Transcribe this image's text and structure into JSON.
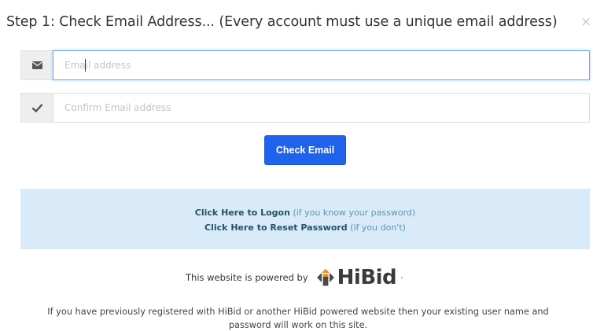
{
  "header": {
    "title": "Step 1: Check Email Address... (Every account must use a unique email address)",
    "close_label": "×"
  },
  "form": {
    "email_placeholder": "Email address",
    "confirm_placeholder": "Confirm Email address",
    "submit_label": "Check Email",
    "email_icon": "envelope-icon",
    "confirm_icon": "checkmark-icon"
  },
  "info": {
    "logon_link": "Click Here to Logon",
    "logon_note": "(if you know your password)",
    "reset_link": "Click Here to Reset Password",
    "reset_note": "(if you don't)"
  },
  "powered": {
    "text": "This website is powered by",
    "brand": "HiBid",
    "suffix": "·"
  },
  "footer": {
    "line1": "If you have previously registered with HiBid or another HiBid powered website then your existing user name and",
    "line2": "password will work on this site."
  },
  "colors": {
    "accent": "#1f62ec",
    "info_bg": "#d9ebf8",
    "link": "#245269",
    "brand_orange": "#f08a24"
  }
}
